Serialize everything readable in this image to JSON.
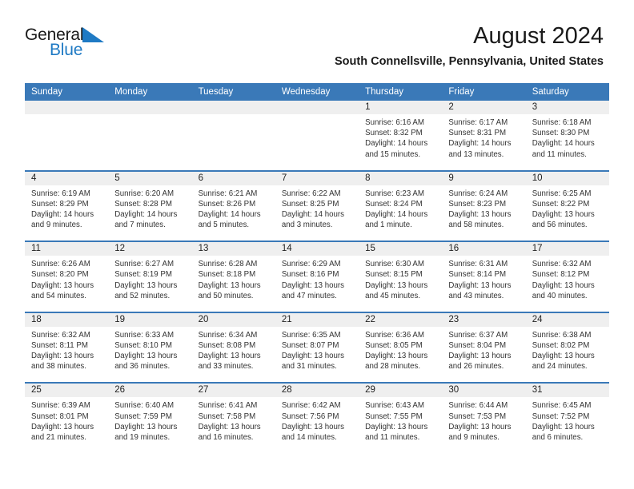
{
  "brand": {
    "name_part1": "General",
    "name_part2": "Blue",
    "flag_icon": "blue-triangle-flag-icon",
    "accent_color": "#1f7ac4"
  },
  "header": {
    "title": "August 2024",
    "location": "South Connellsville, Pennsylvania, United States",
    "header_bg_color": "#3a79b8",
    "date_band_color": "#efefef"
  },
  "weekdays": [
    "Sunday",
    "Monday",
    "Tuesday",
    "Wednesday",
    "Thursday",
    "Friday",
    "Saturday"
  ],
  "weeks": [
    [
      {
        "day": "",
        "sunrise": "",
        "sunset": "",
        "daylight_line1": "",
        "daylight_line2": ""
      },
      {
        "day": "",
        "sunrise": "",
        "sunset": "",
        "daylight_line1": "",
        "daylight_line2": ""
      },
      {
        "day": "",
        "sunrise": "",
        "sunset": "",
        "daylight_line1": "",
        "daylight_line2": ""
      },
      {
        "day": "",
        "sunrise": "",
        "sunset": "",
        "daylight_line1": "",
        "daylight_line2": ""
      },
      {
        "day": "1",
        "sunrise": "Sunrise: 6:16 AM",
        "sunset": "Sunset: 8:32 PM",
        "daylight_line1": "Daylight: 14 hours",
        "daylight_line2": "and 15 minutes."
      },
      {
        "day": "2",
        "sunrise": "Sunrise: 6:17 AM",
        "sunset": "Sunset: 8:31 PM",
        "daylight_line1": "Daylight: 14 hours",
        "daylight_line2": "and 13 minutes."
      },
      {
        "day": "3",
        "sunrise": "Sunrise: 6:18 AM",
        "sunset": "Sunset: 8:30 PM",
        "daylight_line1": "Daylight: 14 hours",
        "daylight_line2": "and 11 minutes."
      }
    ],
    [
      {
        "day": "4",
        "sunrise": "Sunrise: 6:19 AM",
        "sunset": "Sunset: 8:29 PM",
        "daylight_line1": "Daylight: 14 hours",
        "daylight_line2": "and 9 minutes."
      },
      {
        "day": "5",
        "sunrise": "Sunrise: 6:20 AM",
        "sunset": "Sunset: 8:28 PM",
        "daylight_line1": "Daylight: 14 hours",
        "daylight_line2": "and 7 minutes."
      },
      {
        "day": "6",
        "sunrise": "Sunrise: 6:21 AM",
        "sunset": "Sunset: 8:26 PM",
        "daylight_line1": "Daylight: 14 hours",
        "daylight_line2": "and 5 minutes."
      },
      {
        "day": "7",
        "sunrise": "Sunrise: 6:22 AM",
        "sunset": "Sunset: 8:25 PM",
        "daylight_line1": "Daylight: 14 hours",
        "daylight_line2": "and 3 minutes."
      },
      {
        "day": "8",
        "sunrise": "Sunrise: 6:23 AM",
        "sunset": "Sunset: 8:24 PM",
        "daylight_line1": "Daylight: 14 hours",
        "daylight_line2": "and 1 minute."
      },
      {
        "day": "9",
        "sunrise": "Sunrise: 6:24 AM",
        "sunset": "Sunset: 8:23 PM",
        "daylight_line1": "Daylight: 13 hours",
        "daylight_line2": "and 58 minutes."
      },
      {
        "day": "10",
        "sunrise": "Sunrise: 6:25 AM",
        "sunset": "Sunset: 8:22 PM",
        "daylight_line1": "Daylight: 13 hours",
        "daylight_line2": "and 56 minutes."
      }
    ],
    [
      {
        "day": "11",
        "sunrise": "Sunrise: 6:26 AM",
        "sunset": "Sunset: 8:20 PM",
        "daylight_line1": "Daylight: 13 hours",
        "daylight_line2": "and 54 minutes."
      },
      {
        "day": "12",
        "sunrise": "Sunrise: 6:27 AM",
        "sunset": "Sunset: 8:19 PM",
        "daylight_line1": "Daylight: 13 hours",
        "daylight_line2": "and 52 minutes."
      },
      {
        "day": "13",
        "sunrise": "Sunrise: 6:28 AM",
        "sunset": "Sunset: 8:18 PM",
        "daylight_line1": "Daylight: 13 hours",
        "daylight_line2": "and 50 minutes."
      },
      {
        "day": "14",
        "sunrise": "Sunrise: 6:29 AM",
        "sunset": "Sunset: 8:16 PM",
        "daylight_line1": "Daylight: 13 hours",
        "daylight_line2": "and 47 minutes."
      },
      {
        "day": "15",
        "sunrise": "Sunrise: 6:30 AM",
        "sunset": "Sunset: 8:15 PM",
        "daylight_line1": "Daylight: 13 hours",
        "daylight_line2": "and 45 minutes."
      },
      {
        "day": "16",
        "sunrise": "Sunrise: 6:31 AM",
        "sunset": "Sunset: 8:14 PM",
        "daylight_line1": "Daylight: 13 hours",
        "daylight_line2": "and 43 minutes."
      },
      {
        "day": "17",
        "sunrise": "Sunrise: 6:32 AM",
        "sunset": "Sunset: 8:12 PM",
        "daylight_line1": "Daylight: 13 hours",
        "daylight_line2": "and 40 minutes."
      }
    ],
    [
      {
        "day": "18",
        "sunrise": "Sunrise: 6:32 AM",
        "sunset": "Sunset: 8:11 PM",
        "daylight_line1": "Daylight: 13 hours",
        "daylight_line2": "and 38 minutes."
      },
      {
        "day": "19",
        "sunrise": "Sunrise: 6:33 AM",
        "sunset": "Sunset: 8:10 PM",
        "daylight_line1": "Daylight: 13 hours",
        "daylight_line2": "and 36 minutes."
      },
      {
        "day": "20",
        "sunrise": "Sunrise: 6:34 AM",
        "sunset": "Sunset: 8:08 PM",
        "daylight_line1": "Daylight: 13 hours",
        "daylight_line2": "and 33 minutes."
      },
      {
        "day": "21",
        "sunrise": "Sunrise: 6:35 AM",
        "sunset": "Sunset: 8:07 PM",
        "daylight_line1": "Daylight: 13 hours",
        "daylight_line2": "and 31 minutes."
      },
      {
        "day": "22",
        "sunrise": "Sunrise: 6:36 AM",
        "sunset": "Sunset: 8:05 PM",
        "daylight_line1": "Daylight: 13 hours",
        "daylight_line2": "and 28 minutes."
      },
      {
        "day": "23",
        "sunrise": "Sunrise: 6:37 AM",
        "sunset": "Sunset: 8:04 PM",
        "daylight_line1": "Daylight: 13 hours",
        "daylight_line2": "and 26 minutes."
      },
      {
        "day": "24",
        "sunrise": "Sunrise: 6:38 AM",
        "sunset": "Sunset: 8:02 PM",
        "daylight_line1": "Daylight: 13 hours",
        "daylight_line2": "and 24 minutes."
      }
    ],
    [
      {
        "day": "25",
        "sunrise": "Sunrise: 6:39 AM",
        "sunset": "Sunset: 8:01 PM",
        "daylight_line1": "Daylight: 13 hours",
        "daylight_line2": "and 21 minutes."
      },
      {
        "day": "26",
        "sunrise": "Sunrise: 6:40 AM",
        "sunset": "Sunset: 7:59 PM",
        "daylight_line1": "Daylight: 13 hours",
        "daylight_line2": "and 19 minutes."
      },
      {
        "day": "27",
        "sunrise": "Sunrise: 6:41 AM",
        "sunset": "Sunset: 7:58 PM",
        "daylight_line1": "Daylight: 13 hours",
        "daylight_line2": "and 16 minutes."
      },
      {
        "day": "28",
        "sunrise": "Sunrise: 6:42 AM",
        "sunset": "Sunset: 7:56 PM",
        "daylight_line1": "Daylight: 13 hours",
        "daylight_line2": "and 14 minutes."
      },
      {
        "day": "29",
        "sunrise": "Sunrise: 6:43 AM",
        "sunset": "Sunset: 7:55 PM",
        "daylight_line1": "Daylight: 13 hours",
        "daylight_line2": "and 11 minutes."
      },
      {
        "day": "30",
        "sunrise": "Sunrise: 6:44 AM",
        "sunset": "Sunset: 7:53 PM",
        "daylight_line1": "Daylight: 13 hours",
        "daylight_line2": "and 9 minutes."
      },
      {
        "day": "31",
        "sunrise": "Sunrise: 6:45 AM",
        "sunset": "Sunset: 7:52 PM",
        "daylight_line1": "Daylight: 13 hours",
        "daylight_line2": "and 6 minutes."
      }
    ]
  ]
}
